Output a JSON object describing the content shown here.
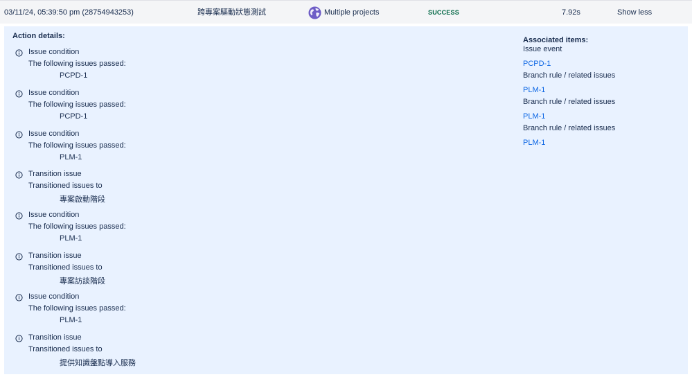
{
  "header": {
    "date": "03/11/24, 05:39:50 pm (28754943253)",
    "rule_name": "跨專案驅動狀態測試",
    "projects": "Multiple projects",
    "projects_icon": "globe-icon",
    "status": "SUCCESS",
    "status_color": "#006644",
    "duration": "7.92s",
    "toggle_label": "Show less"
  },
  "details": {
    "title": "Action details:",
    "actions": [
      {
        "title": "Issue condition",
        "subtitle": "The following issues passed:",
        "value": "PCPD-1"
      },
      {
        "title": "Issue condition",
        "subtitle": "The following issues passed:",
        "value": "PCPD-1"
      },
      {
        "title": "Issue condition",
        "subtitle": "The following issues passed:",
        "value": "PLM-1"
      },
      {
        "title": "Transition issue",
        "subtitle": "Transitioned issues to",
        "value": "專案啟動階段"
      },
      {
        "title": "Issue condition",
        "subtitle": "The following issues passed:",
        "value": "PLM-1"
      },
      {
        "title": "Transition issue",
        "subtitle": "Transitioned issues to",
        "value": "專案訪談階段"
      },
      {
        "title": "Issue condition",
        "subtitle": "The following issues passed:",
        "value": "PLM-1"
      },
      {
        "title": "Transition issue",
        "subtitle": "Transitioned issues to",
        "value": "提供知識盤點導入服務"
      }
    ]
  },
  "associated": {
    "title": "Associated items:",
    "groups": [
      {
        "label": "Issue event",
        "link": "PCPD-1"
      },
      {
        "label": "Branch rule / related issues",
        "link": "PLM-1"
      },
      {
        "label": "Branch rule / related issues",
        "link": "PLM-1"
      },
      {
        "label": "Branch rule / related issues",
        "link": "PLM-1"
      }
    ]
  },
  "colors": {
    "panel_bg": "#e9f2ff",
    "link": "#0c66e4",
    "header_bg": "#f4f5f7"
  }
}
